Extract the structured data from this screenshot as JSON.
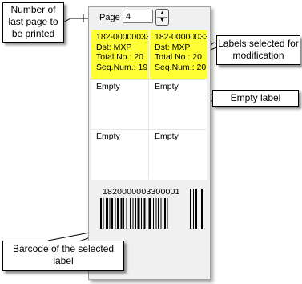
{
  "page": {
    "label": "Page",
    "value": "4"
  },
  "labels": {
    "row1": [
      {
        "line1": "182-00000033",
        "dst_prefix": "Dst: ",
        "dst_code": "MXP",
        "total": "Total No.: 20",
        "seq": "Seq.Num.: 19"
      },
      {
        "line1": "182-00000033",
        "dst_prefix": "Dst: ",
        "dst_code": "MXP",
        "total": "Total No.: 20",
        "seq": "Seq.Num.: 20"
      }
    ],
    "row2": [
      "Empty",
      "Empty"
    ],
    "row3": [
      "Empty",
      "Empty"
    ]
  },
  "barcode": {
    "number": "1820000003300001"
  },
  "callouts": {
    "last_page": "Number of last page to be printed",
    "selected": "Labels selected for modification",
    "empty": "Empty label",
    "barcode": "Barcode of the selected label"
  },
  "colors": {
    "selected": "#ffff33",
    "panel": "#f0f0f0"
  }
}
